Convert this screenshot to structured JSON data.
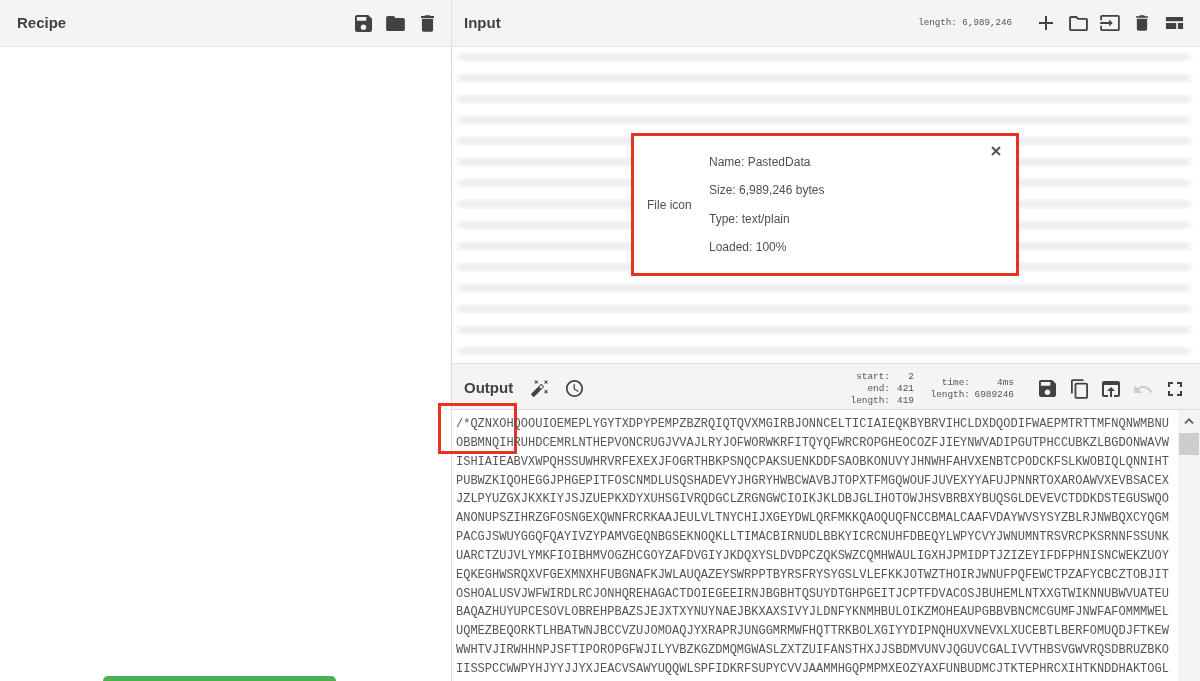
{
  "recipe": {
    "title": "Recipe"
  },
  "input": {
    "title": "Input",
    "length": "length: 6,989,246",
    "file_details": {
      "image_alt": "File icon",
      "lines": [
        "Name: PastedData",
        "Size: 6,989,246 bytes",
        "Type: text/plain",
        "Loaded: 100%"
      ]
    }
  },
  "output": {
    "title": "Output",
    "selection_stats": [
      {
        "label": "start:",
        "value": "2"
      },
      {
        "label": "end:",
        "value": "421"
      },
      {
        "label": "length:",
        "value": "419"
      }
    ],
    "timing_stats": [
      {
        "label": "time:",
        "value": "4ms"
      },
      {
        "label": "length:",
        "value": "6989246"
      }
    ],
    "toolbar": [
      {
        "kind": "save",
        "disabled": false
      },
      {
        "kind": "copy",
        "disabled": false
      },
      {
        "kind": "export",
        "disabled": false
      },
      {
        "kind": "undo",
        "disabled": true
      },
      {
        "kind": "fullscreen",
        "disabled": false
      }
    ],
    "lines": [
      "/*QZNXOHQOOUIOEMEPLYGYTXDPYPEMPZBZRQIQTQVXMGIRBJONNCELTICIAIEQKBYBRVIHCLDXDQODIFWAEPMTRTTMFNQNWMBNU",
      "OBBMNQIHRUHDCEMRLNTHEPVONCRUGJVVAJLRYJOFWORWKRFITQYQFWRCROPGHEOCOZFJIEYNWVADIPGUTPHCCUBKZLBGDONWAVW",
      "ISHIAIEABVXWPQHSSUWHRVRFEXEXJFOGRTHBKPSNQCPAKSUENKDDFSAOBKONUVYJHNWHFAHVXENBTCPODCKFSLKWOBIQLQNNIHT",
      "PUBWZKIQOHEGGJPHGEPITFOSCNMDLUSQSHADEVYJHGRYHWBCWAVBJTOPXTFMGQWOUFJUVEXYYAFUJPNNRTOXAROAWVXEVBSACEX",
      "JZLPYUZGXJKXKIYJSJZUEPKXDYXUHSGIVRQDGCLZRGNGWCIOIKJKLDBJGLIHOTOWJHSVBRBXYBUQSGLDEVEVCTDDKDSTEGUSWQO",
      "ANONUPSZIHRZGFOSNGEXQWNFRCRKAAJEULVLTNYCHIJXGEYDWLQRFMKKQAOQUQFNCCBMALCAAFVDAYWVSYSYZBLRJNWBQXCYQGM",
      "PACGJSWUYGGQFQAYIVZYPAMVGEQNBGSEKNOQKLLTIMACBIRNUDLBBKYICRCNUHFDBEQYLWPYCVYJWNUMNTRSVRCPKSRNNFSSUNK",
      "UARCTZUJVLYMKFIOIBHMVOGZHCGOYZAFDVGIYJKDQXYSLDVDPCZQKSWZCQMHWAULIGXHJPMIDPTJZIZEYIFDFPHNISNCWEKZUOY",
      "EQKEGHWSRQXVFGEXMNXHFUBGNAFKJWLAUQAZEYSWRPPTBYRSFRYSYGSLVLEFKKJOTWZTHOIRJWNUFPQFEWCTPZAFYCBCZTOBJIT",
      "OSHOALUSVJWFWIRDLRCJONHQREHAGACTDOIEGEEIRNJBGBHTQSUYDTGHPGEITJCPTFDVACOSJBUHEMLNTXXGTWIKNNUBWVUATEU",
      "BAQAZHUYUPCESOVLOBREHPBAZSJEJXTXYNUYNAEJBKXAXSIVYJLDNFYKNMHBULOIKZMOHEAUPGBBVBNCMCGUMFJNWFAFOMMMWEL",
      "UQMEZBEQORKTLHBATWNJBCCVZUJOMOAQJYXRAPRJUNGGMRMWFHQTTRKBOLXGIYYDIPNQHUXVNEVXLXUCEBTLBERFOMUQDJFTKEW",
      "WWHTVJIRWHHNPJSFTIPOROPGFWJILYVBZKGZDMQMGWASLZXTZUIFANSTHXJJSBDMVUNVJQGUVCGALIVVTHBSVGWVRQSDBRUZBKO",
      "IISSPCCWWPYHJYYJJYXJEACVSAWYUQQWLSPFIDKRFSUPYCVVJAAMMHGQPMPMXEOZYAXFUNBUDMCJTKTEPHRCXIHTKNDDHAKTOGL"
    ]
  }
}
